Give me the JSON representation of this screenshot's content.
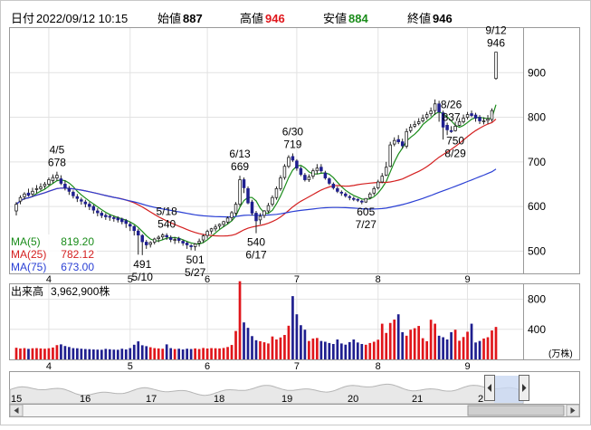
{
  "header": {
    "date_label": "日付",
    "datetime": "2022/09/12 10:15",
    "open_label": "始値",
    "open_value": "887",
    "high_label": "高値",
    "high_value": "946",
    "low_label": "安値",
    "low_value": "884",
    "close_label": "終値",
    "close_value": "946"
  },
  "colors": {
    "up": "#1a1a1a",
    "down": "#1f1f8f",
    "ma5": "#1a8c1a",
    "ma25": "#d42020",
    "ma75": "#2a3fd4",
    "high_text": "#e0161b",
    "low_text": "#1a8c1a",
    "volume": "#1f1f8f",
    "volume_up": "#e0161b"
  },
  "legend": [
    {
      "label": "MA(5)",
      "value": "819.20",
      "color": "#1a8c1a"
    },
    {
      "label": "MA(25)",
      "value": "782.12",
      "color": "#d42020"
    },
    {
      "label": "MA(75)",
      "value": "673.00",
      "color": "#2a3fd4"
    }
  ],
  "annotations": [
    {
      "date": "4/5",
      "price": "678",
      "anchor": "4/5"
    },
    {
      "date": "5/18",
      "price": "540",
      "anchor": "5/18"
    },
    {
      "date": "6/13",
      "price": "669",
      "anchor": "6/13"
    },
    {
      "date": "6/30",
      "price": "719",
      "anchor": "6/30"
    },
    {
      "date": "8/26",
      "price": "837",
      "anchor": "8/26"
    },
    {
      "date": "9/12",
      "price": "946",
      "anchor": "9/12"
    },
    {
      "date": "5/10",
      "price": "491",
      "anchor": "5/10",
      "below": true
    },
    {
      "date": "5/27",
      "price": "501",
      "anchor": "5/27",
      "below": true
    },
    {
      "date": "6/17",
      "price": "540",
      "anchor": "6/17",
      "below": true
    },
    {
      "date": "7/27",
      "price": "605",
      "anchor": "7/27",
      "below": true
    },
    {
      "date": "8/29",
      "price": "750",
      "anchor": "8/29",
      "below": true
    }
  ],
  "volume_label": "出来高",
  "volume_value": "3,962,900株",
  "volume_unit": "(万株)",
  "navigator_ticks": [
    "15",
    "16",
    "17",
    "18",
    "19",
    "20",
    "21",
    "2"
  ],
  "chart_data": {
    "type": "candlestick",
    "price_axis": {
      "ticks": [
        500,
        600,
        700,
        800,
        900
      ],
      "ylim": [
        450,
        1000
      ]
    },
    "volume_axis": {
      "ticks": [
        400,
        800
      ],
      "unit": "万株",
      "ylim": [
        0,
        1000
      ]
    },
    "x_ticks": [
      "4",
      "5",
      "6",
      "7",
      "8",
      "9"
    ],
    "dates": [
      "3/22",
      "3/23",
      "3/24",
      "3/25",
      "3/28",
      "3/29",
      "3/30",
      "3/31",
      "4/1",
      "4/4",
      "4/5",
      "4/6",
      "4/7",
      "4/8",
      "4/11",
      "4/12",
      "4/13",
      "4/14",
      "4/15",
      "4/18",
      "4/19",
      "4/20",
      "4/21",
      "4/22",
      "4/25",
      "4/26",
      "4/27",
      "4/28",
      "5/2",
      "5/6",
      "5/9",
      "5/10",
      "5/11",
      "5/12",
      "5/13",
      "5/16",
      "5/17",
      "5/18",
      "5/19",
      "5/20",
      "5/23",
      "5/24",
      "5/25",
      "5/26",
      "5/27",
      "5/30",
      "5/31",
      "6/1",
      "6/2",
      "6/3",
      "6/6",
      "6/7",
      "6/8",
      "6/9",
      "6/10",
      "6/13",
      "6/14",
      "6/15",
      "6/16",
      "6/17",
      "6/20",
      "6/21",
      "6/22",
      "6/23",
      "6/24",
      "6/27",
      "6/28",
      "6/29",
      "6/30",
      "7/1",
      "7/4",
      "7/5",
      "7/6",
      "7/7",
      "7/8",
      "7/11",
      "7/12",
      "7/13",
      "7/14",
      "7/15",
      "7/19",
      "7/20",
      "7/21",
      "7/22",
      "7/25",
      "7/26",
      "7/27",
      "7/28",
      "7/29",
      "8/1",
      "8/2",
      "8/3",
      "8/4",
      "8/5",
      "8/8",
      "8/9",
      "8/10",
      "8/12",
      "8/15",
      "8/16",
      "8/17",
      "8/18",
      "8/19",
      "8/22",
      "8/23",
      "8/24",
      "8/25",
      "8/26",
      "8/29",
      "8/30",
      "8/31",
      "9/1",
      "9/2",
      "9/5",
      "9/6",
      "9/7",
      "9/8",
      "9/9",
      "9/12"
    ],
    "open": [
      590,
      612,
      622,
      630,
      628,
      638,
      640,
      646,
      650,
      658,
      664,
      662,
      650,
      640,
      632,
      622,
      615,
      610,
      605,
      600,
      590,
      585,
      580,
      578,
      575,
      574,
      572,
      568,
      560,
      555,
      545,
      535,
      520,
      515,
      520,
      528,
      532,
      535,
      530,
      525,
      528,
      522,
      518,
      512,
      510,
      518,
      525,
      535,
      545,
      550,
      556,
      560,
      565,
      575,
      585,
      605,
      660,
      640,
      610,
      585,
      570,
      580,
      590,
      605,
      620,
      640,
      665,
      690,
      712,
      702,
      685,
      670,
      660,
      668,
      680,
      688,
      675,
      662,
      650,
      640,
      632,
      628,
      622,
      618,
      616,
      612,
      610,
      620,
      630,
      642,
      655,
      670,
      690,
      740,
      750,
      745,
      735,
      770,
      780,
      786,
      792,
      800,
      808,
      815,
      830,
      810,
      782,
      770,
      770,
      782,
      790,
      800,
      808,
      805,
      800,
      790,
      793,
      795,
      887
    ],
    "high": [
      610,
      625,
      632,
      640,
      642,
      648,
      652,
      655,
      665,
      672,
      678,
      670,
      658,
      646,
      636,
      628,
      620,
      615,
      610,
      604,
      596,
      590,
      585,
      582,
      580,
      578,
      575,
      572,
      565,
      558,
      550,
      538,
      525,
      522,
      530,
      535,
      540,
      540,
      535,
      532,
      532,
      526,
      522,
      516,
      518,
      528,
      538,
      548,
      552,
      560,
      562,
      568,
      578,
      590,
      610,
      669,
      665,
      645,
      615,
      590,
      585,
      592,
      608,
      625,
      645,
      670,
      695,
      715,
      719,
      706,
      690,
      675,
      672,
      685,
      695,
      695,
      680,
      665,
      654,
      645,
      636,
      632,
      626,
      622,
      618,
      615,
      618,
      632,
      645,
      660,
      675,
      700,
      745,
      755,
      760,
      752,
      775,
      785,
      792,
      798,
      806,
      812,
      822,
      840,
      837,
      815,
      788,
      780,
      790,
      798,
      806,
      812,
      815,
      810,
      805,
      800,
      805,
      820,
      946
    ],
    "low": [
      580,
      605,
      615,
      622,
      622,
      630,
      636,
      640,
      646,
      652,
      658,
      648,
      636,
      626,
      618,
      610,
      604,
      598,
      592,
      584,
      578,
      574,
      570,
      568,
      566,
      564,
      560,
      552,
      545,
      535,
      492,
      491,
      505,
      508,
      515,
      520,
      525,
      525,
      520,
      516,
      518,
      512,
      505,
      502,
      501,
      510,
      518,
      528,
      538,
      544,
      550,
      554,
      560,
      568,
      580,
      600,
      630,
      605,
      580,
      540,
      560,
      574,
      585,
      600,
      615,
      635,
      660,
      686,
      700,
      680,
      668,
      656,
      655,
      662,
      672,
      675,
      660,
      648,
      638,
      630,
      624,
      620,
      614,
      612,
      610,
      605,
      608,
      616,
      625,
      638,
      652,
      668,
      688,
      735,
      740,
      730,
      730,
      765,
      776,
      782,
      788,
      795,
      802,
      805,
      790,
      750,
      760,
      765,
      768,
      780,
      786,
      795,
      800,
      790,
      785,
      784,
      785,
      790,
      884
    ],
    "close": [
      605,
      620,
      628,
      625,
      634,
      640,
      644,
      650,
      660,
      665,
      670,
      652,
      642,
      634,
      624,
      618,
      612,
      606,
      600,
      592,
      586,
      580,
      577,
      576,
      573,
      570,
      566,
      562,
      556,
      546,
      536,
      521,
      514,
      519,
      527,
      531,
      536,
      532,
      526,
      526,
      524,
      518,
      514,
      510,
      516,
      522,
      534,
      544,
      550,
      554,
      560,
      566,
      574,
      586,
      605,
      660,
      642,
      608,
      585,
      568,
      578,
      590,
      602,
      620,
      640,
      664,
      690,
      710,
      704,
      686,
      672,
      660,
      666,
      680,
      686,
      680,
      664,
      652,
      642,
      634,
      630,
      624,
      620,
      616,
      614,
      610,
      618,
      628,
      640,
      655,
      668,
      688,
      738,
      748,
      745,
      736,
      768,
      778,
      784,
      790,
      798,
      806,
      814,
      830,
      812,
      778,
      772,
      768,
      780,
      790,
      798,
      806,
      804,
      798,
      792,
      792,
      796,
      815,
      946
    ],
    "volume": [
      155,
      145,
      150,
      140,
      148,
      150,
      146,
      142,
      148,
      158,
      190,
      200,
      178,
      165,
      150,
      148,
      142,
      138,
      136,
      132,
      130,
      128,
      140,
      135,
      130,
      128,
      142,
      132,
      150,
      195,
      240,
      188,
      176,
      162,
      150,
      146,
      142,
      200,
      150,
      138,
      142,
      132,
      142,
      138,
      146,
      138,
      152,
      145,
      150,
      148,
      146,
      152,
      165,
      192,
      378,
      1040,
      492,
      420,
      310,
      255,
      242,
      228,
      212,
      305,
      265,
      292,
      325,
      448,
      842,
      600,
      455,
      395,
      245,
      278,
      285,
      245,
      235,
      218,
      205,
      265,
      212,
      196,
      230,
      265,
      225,
      205,
      195,
      218,
      235,
      262,
      475,
      352,
      485,
      530,
      600,
      362,
      315,
      395,
      415,
      445,
      282,
      242,
      528,
      475,
      315,
      295,
      265,
      362,
      395,
      248,
      298,
      368,
      475,
      225,
      245,
      278,
      295,
      385,
      432
    ]
  }
}
